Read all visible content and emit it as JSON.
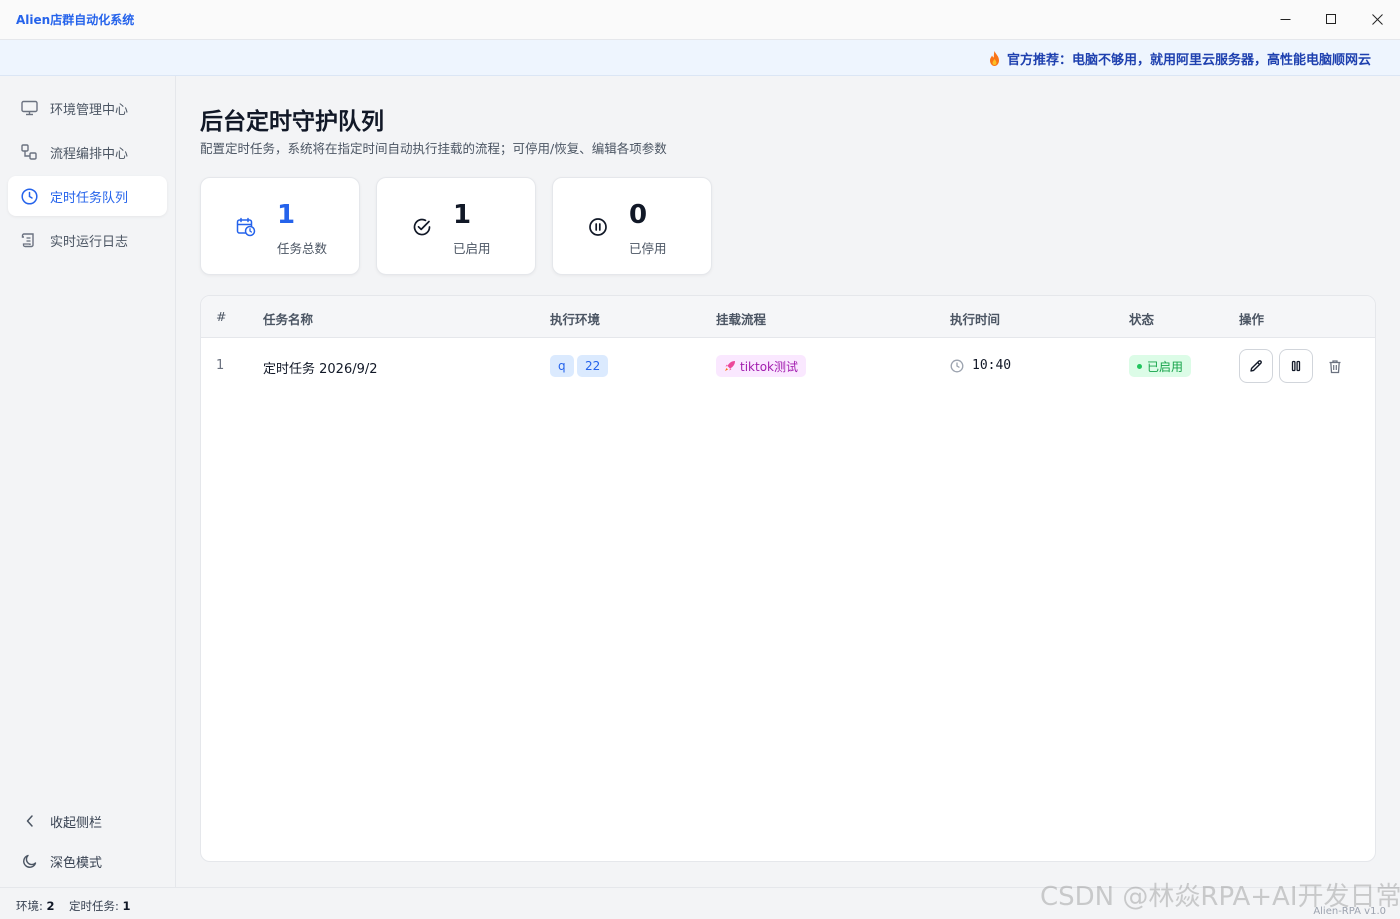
{
  "window": {
    "title": "Alien店群自动化系统"
  },
  "banner": {
    "text": "官方推荐：电脑不够用，就用阿里云服务器，高性能电脑顺网云"
  },
  "sidebar": {
    "items": [
      {
        "label": "环境管理中心",
        "icon": "monitor-icon"
      },
      {
        "label": "流程编排中心",
        "icon": "workflow-icon"
      },
      {
        "label": "定时任务队列",
        "icon": "clock-icon",
        "active": true
      },
      {
        "label": "实时运行日志",
        "icon": "scroll-icon"
      }
    ],
    "collapse_label": "收起侧栏",
    "dark_mode_label": "深色模式"
  },
  "main": {
    "title": "后台定时守护队列",
    "subtitle": "配置定时任务，系统将在指定时间自动执行挂载的流程；可停用/恢复、编辑各项参数"
  },
  "stats": [
    {
      "value": "1",
      "label": "任务总数",
      "icon": "calendar-clock-icon",
      "color": "#2563eb"
    },
    {
      "value": "1",
      "label": "已启用",
      "icon": "check-circle-icon"
    },
    {
      "value": "0",
      "label": "已停用",
      "icon": "pause-circle-icon"
    }
  ],
  "table": {
    "headers": [
      "#",
      "任务名称",
      "执行环境",
      "挂载流程",
      "执行时间",
      "状态",
      "操作"
    ],
    "rows": [
      {
        "index": "1",
        "name": "定时任务 2026/9/2",
        "envs": [
          "q",
          "22"
        ],
        "flow": "tiktok测试",
        "time": "10:40",
        "status": "已启用"
      }
    ]
  },
  "statusbar": {
    "env_label": "环境:",
    "env_count": "2",
    "task_label": "定时任务:",
    "task_count": "1",
    "version": "Alien-RPA v1.0"
  },
  "watermark": "CSDN @林焱RPA+AI开发日常"
}
